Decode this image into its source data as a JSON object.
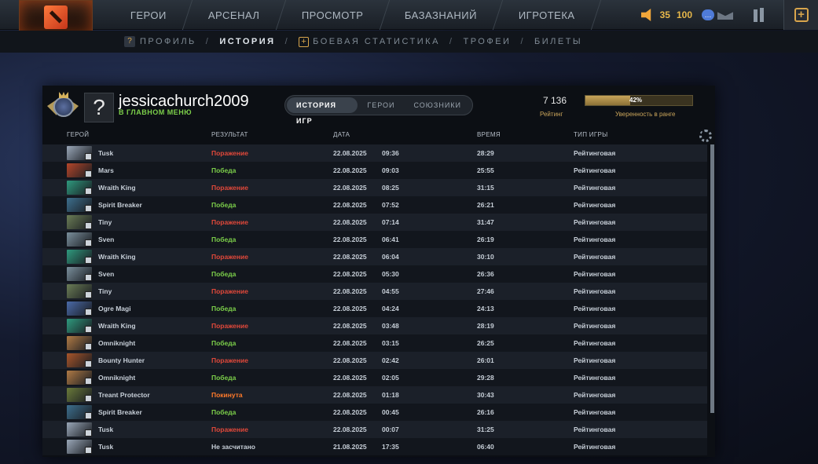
{
  "topnav": {
    "items": [
      "ГЕРОИ",
      "АРСЕНАЛ",
      "ПРОСМОТР",
      "БАЗАЗНАНИЙ",
      "ИГРОТЕКА"
    ],
    "coins": "35",
    "shards": "100"
  },
  "subnav": {
    "profile": "ПРОФИЛЬ",
    "history": "ИСТОРИЯ",
    "stats": "БОЕВАЯ СТАТИСТИКА",
    "trophies": "ТРОФЕИ",
    "tickets": "БИЛЕТЫ",
    "separator": "/"
  },
  "profile": {
    "username": "jessicachurch2009",
    "status": "В ГЛАВНОМ МЕНЮ",
    "avatar_glyph": "?"
  },
  "tabs": [
    "ИСТОРИЯ ИГР",
    "ГЕРОИ",
    "СОЮЗНИКИ"
  ],
  "rating": {
    "value": "7 136",
    "label": "Рейтинг",
    "confidence_percent": 42,
    "confidence_text": "42%",
    "confidence_label": "Уверенность в ранге"
  },
  "table": {
    "headers": {
      "hero": "ГЕРОЙ",
      "result": "РЕЗУЛЬТАТ",
      "date": "ДАТА",
      "time": "ВРЕМЯ",
      "type": "ТИП ИГРЫ"
    },
    "rows": [
      {
        "hero": "Tusk",
        "result": "Поражение",
        "status": "loss",
        "date": "22.08.2025",
        "clock": "09:36",
        "duration": "28:29",
        "type": "Рейтинговая",
        "color": "#9aa7b8"
      },
      {
        "hero": "Mars",
        "result": "Победа",
        "status": "win",
        "date": "22.08.2025",
        "clock": "09:03",
        "duration": "25:55",
        "type": "Рейтинговая",
        "color": "#b5462a"
      },
      {
        "hero": "Wraith King",
        "result": "Поражение",
        "status": "loss",
        "date": "22.08.2025",
        "clock": "08:25",
        "duration": "31:15",
        "type": "Рейтинговая",
        "color": "#2f9a7e"
      },
      {
        "hero": "Spirit Breaker",
        "result": "Победа",
        "status": "win",
        "date": "22.08.2025",
        "clock": "07:52",
        "duration": "26:21",
        "type": "Рейтинговая",
        "color": "#3d6f8e"
      },
      {
        "hero": "Tiny",
        "result": "Поражение",
        "status": "loss",
        "date": "22.08.2025",
        "clock": "07:14",
        "duration": "31:47",
        "type": "Рейтинговая",
        "color": "#6b7d56"
      },
      {
        "hero": "Sven",
        "result": "Победа",
        "status": "win",
        "date": "22.08.2025",
        "clock": "06:41",
        "duration": "26:19",
        "type": "Рейтинговая",
        "color": "#7a8f9c"
      },
      {
        "hero": "Wraith King",
        "result": "Поражение",
        "status": "loss",
        "date": "22.08.2025",
        "clock": "06:04",
        "duration": "30:10",
        "type": "Рейтинговая",
        "color": "#2f9a7e"
      },
      {
        "hero": "Sven",
        "result": "Победа",
        "status": "win",
        "date": "22.08.2025",
        "clock": "05:30",
        "duration": "26:36",
        "type": "Рейтинговая",
        "color": "#7a8f9c"
      },
      {
        "hero": "Tiny",
        "result": "Поражение",
        "status": "loss",
        "date": "22.08.2025",
        "clock": "04:55",
        "duration": "27:46",
        "type": "Рейтинговая",
        "color": "#6b7d56"
      },
      {
        "hero": "Ogre Magi",
        "result": "Победа",
        "status": "win",
        "date": "22.08.2025",
        "clock": "04:24",
        "duration": "24:13",
        "type": "Рейтинговая",
        "color": "#4a6aa8"
      },
      {
        "hero": "Wraith King",
        "result": "Поражение",
        "status": "loss",
        "date": "22.08.2025",
        "clock": "03:48",
        "duration": "28:19",
        "type": "Рейтинговая",
        "color": "#2f9a7e"
      },
      {
        "hero": "Omniknight",
        "result": "Победа",
        "status": "win",
        "date": "22.08.2025",
        "clock": "03:15",
        "duration": "26:25",
        "type": "Рейтинговая",
        "color": "#b07a45"
      },
      {
        "hero": "Bounty Hunter",
        "result": "Поражение",
        "status": "loss",
        "date": "22.08.2025",
        "clock": "02:42",
        "duration": "26:01",
        "type": "Рейтинговая",
        "color": "#a8552a"
      },
      {
        "hero": "Omniknight",
        "result": "Победа",
        "status": "win",
        "date": "22.08.2025",
        "clock": "02:05",
        "duration": "29:28",
        "type": "Рейтинговая",
        "color": "#b07a45"
      },
      {
        "hero": "Treant Protector",
        "result": "Покинута",
        "status": "abandon",
        "date": "22.08.2025",
        "clock": "01:18",
        "duration": "30:43",
        "type": "Рейтинговая",
        "color": "#6a7a3a"
      },
      {
        "hero": "Spirit Breaker",
        "result": "Победа",
        "status": "win",
        "date": "22.08.2025",
        "clock": "00:45",
        "duration": "26:16",
        "type": "Рейтинговая",
        "color": "#3d6f8e"
      },
      {
        "hero": "Tusk",
        "result": "Поражение",
        "status": "loss",
        "date": "22.08.2025",
        "clock": "00:07",
        "duration": "31:25",
        "type": "Рейтинговая",
        "color": "#9aa7b8"
      },
      {
        "hero": "Tusk",
        "result": "Не засчитано",
        "status": "none",
        "date": "21.08.2025",
        "clock": "17:35",
        "duration": "06:40",
        "type": "Рейтинговая",
        "color": "#9aa7b8"
      }
    ]
  }
}
